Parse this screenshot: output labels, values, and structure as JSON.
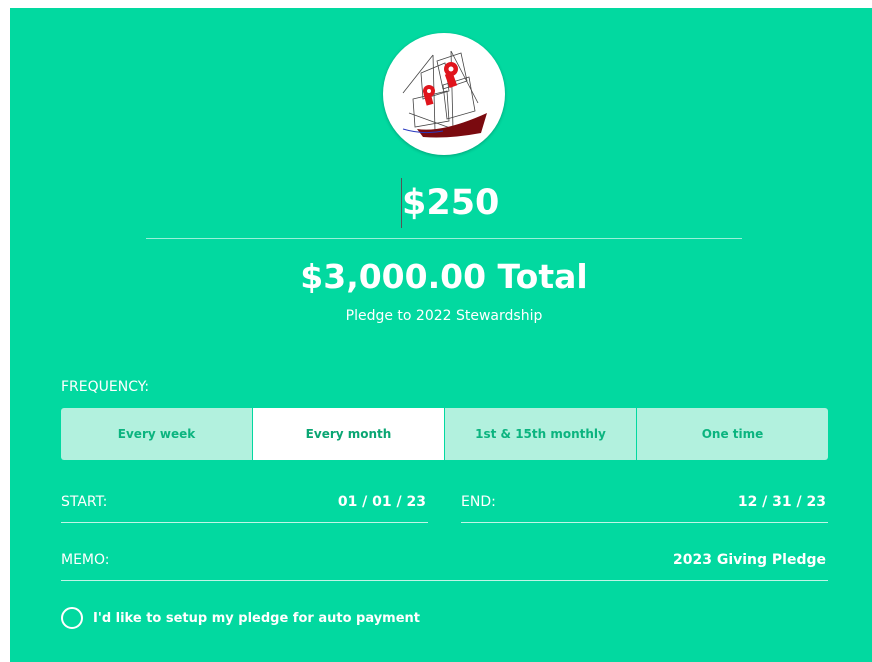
{
  "pledge": {
    "amount": "$250",
    "total": "$3,000.00 Total",
    "subtitle": "Pledge to 2022 Stewardship"
  },
  "frequency": {
    "label": "FREQUENCY:",
    "options": [
      "Every week",
      "Every month",
      "1st & 15th monthly",
      "One time"
    ],
    "selected": "Every month"
  },
  "dates": {
    "start_label": "START:",
    "start_value": "01 / 01 / 23",
    "end_label": "END:",
    "end_value": "12 / 31 / 23"
  },
  "memo": {
    "label": "MEMO:",
    "value": "2023 Giving Pledge"
  },
  "auto_payment": {
    "label": "I'd like to setup my pledge for auto payment",
    "checked": false
  },
  "colors": {
    "background": "#02d9a0",
    "option_bg": "#b2f1de",
    "option_text": "#0bb47f",
    "selected_bg": "#ffffff"
  },
  "icons": {
    "logo": "ship-logo-icon"
  }
}
